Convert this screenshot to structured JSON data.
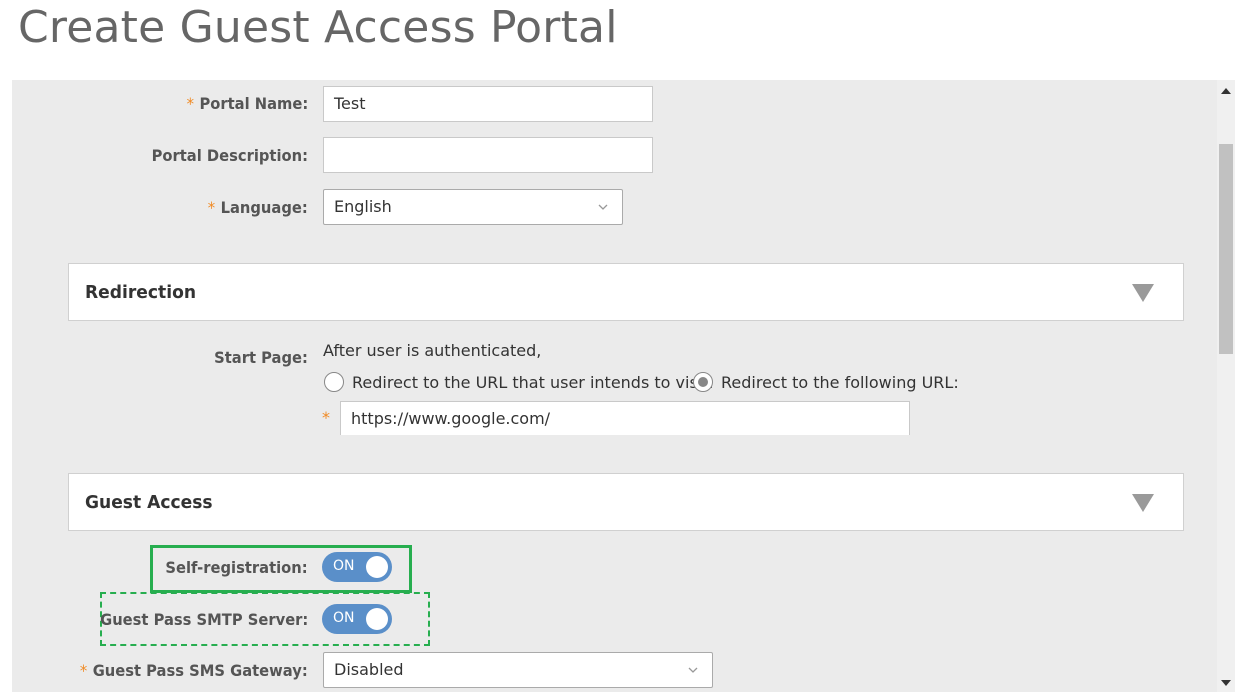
{
  "page": {
    "title": "Create Guest Access Portal"
  },
  "form": {
    "required_mark": "*",
    "portal_name": {
      "label": "Portal Name:",
      "value": "Test"
    },
    "portal_description": {
      "label": "Portal Description:",
      "value": ""
    },
    "language": {
      "label": "Language:",
      "value": "English"
    }
  },
  "redirection": {
    "title": "Redirection",
    "start_page_label": "Start Page:",
    "intro": "After user is authenticated,",
    "options": [
      {
        "label": "Redirect to the URL that user intends to visit.",
        "selected": false
      },
      {
        "label": "Redirect to the following URL:",
        "selected": true
      }
    ],
    "url": "https://www.google.com/"
  },
  "guest_access": {
    "title": "Guest Access",
    "self_registration": {
      "label": "Self-registration:",
      "state": "ON"
    },
    "smtp_server": {
      "label": "Guest Pass SMTP Server:",
      "state": "ON"
    },
    "sms_gateway": {
      "label": "Guest Pass SMS Gateway:",
      "value": "Disabled"
    }
  },
  "colors": {
    "accent": "#5a8fc9",
    "highlight": "#27ae4f",
    "required": "#f08a24"
  },
  "icons": {
    "collapse": "triangle-down-icon",
    "select_arrow": "chevron-down-icon"
  }
}
